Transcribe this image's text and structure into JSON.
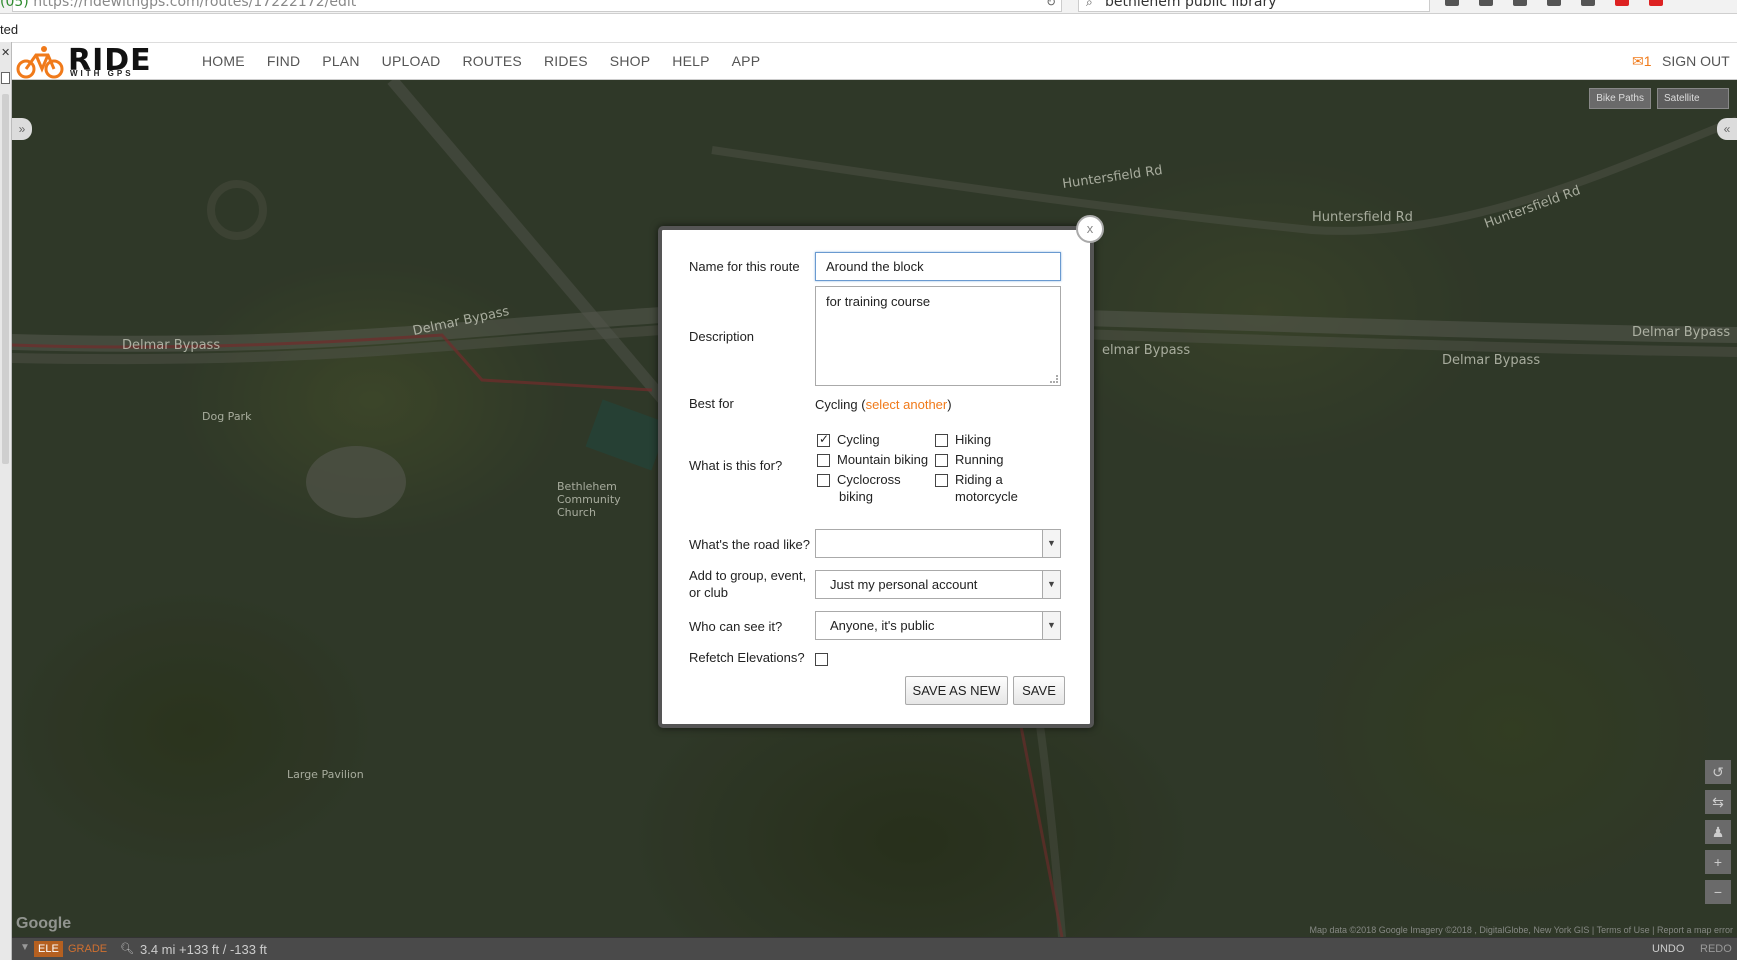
{
  "browser": {
    "url_prefix": "(05)",
    "url_host": "https://ridewithgps.com",
    "url_path": "/routes/17222172/edit",
    "search_query": "bethlehem public library",
    "notification_fragment": "ted"
  },
  "header": {
    "logo_main": "RIDE",
    "logo_sub": "WITH GPS",
    "nav": [
      "HOME",
      "FIND",
      "PLAN",
      "UPLOAD",
      "ROUTES",
      "RIDES",
      "SHOP",
      "HELP",
      "APP"
    ],
    "mail_count": "1",
    "signout": "SIGN OUT"
  },
  "map": {
    "labels": {
      "delmar_bypass_left": "Delmar Bypass",
      "delmar_bypass_center": "Delmar Bypass",
      "delmar_bypass_right": "Delmar Bypass",
      "delmar_bypass_right2": "elmar Bypass",
      "delmar_bypass_far": "Delmar Bypass",
      "huntersfield_1": "Huntersfield Rd",
      "huntersfield_2": "Huntersfield Rd",
      "huntersfield_3": "Huntersfield Rd",
      "dog_park": "Dog Park",
      "church": "Bethlehem Community Church",
      "large_pavilion": "Large Pavilion"
    },
    "bike_paths": "Bike Paths",
    "map_type": "Satellite",
    "google": "Google",
    "attribution": "Map data ©2018 Google Imagery ©2018 , DigitalGlobe, New York GIS | Terms of Use | Report a map error"
  },
  "dialog": {
    "close": "x",
    "name_label": "Name for this route",
    "name_value": "Around the block",
    "description_label": "Description",
    "description_value": "for training course",
    "best_for_label": "Best for",
    "best_for_value": "Cycling",
    "best_for_link": "select another",
    "purpose_label": "What is this for?",
    "activities": [
      {
        "label": "Cycling",
        "checked": true
      },
      {
        "label": "Mountain biking",
        "checked": false
      },
      {
        "label": "Cyclocross biking",
        "checked": false
      },
      {
        "label": "Hiking",
        "checked": false
      },
      {
        "label": "Running",
        "checked": false
      },
      {
        "label": "Riding a motorcycle",
        "checked": false
      }
    ],
    "activity_labels": {
      "cycling": "Cycling",
      "mountain": "Mountain biking",
      "cyclocross_1": "Cyclocross",
      "cyclocross_2": "biking",
      "hiking": "Hiking",
      "running": "Running",
      "moto_1": "Riding a",
      "moto_2": "motorcycle"
    },
    "road_label": "What's the road like?",
    "road_value": "",
    "group_label_1": "Add to group, event,",
    "group_label_2": "or club",
    "group_value": "Just my personal account",
    "visibility_label": "Who can see it?",
    "visibility_value": "Anyone, it's public",
    "refetch_label": "Refetch Elevations?",
    "refetch_checked": false,
    "save_as_new": "SAVE AS NEW",
    "save": "SAVE"
  },
  "status_bar": {
    "ele": "ELE",
    "grade": "GRADE",
    "stats": "3.4 mi +133 ft / -133 ft",
    "undo": "UNDO",
    "redo": "REDO"
  },
  "colors": {
    "brand_orange": "#f07a1a",
    "route_red": "#b04040"
  }
}
